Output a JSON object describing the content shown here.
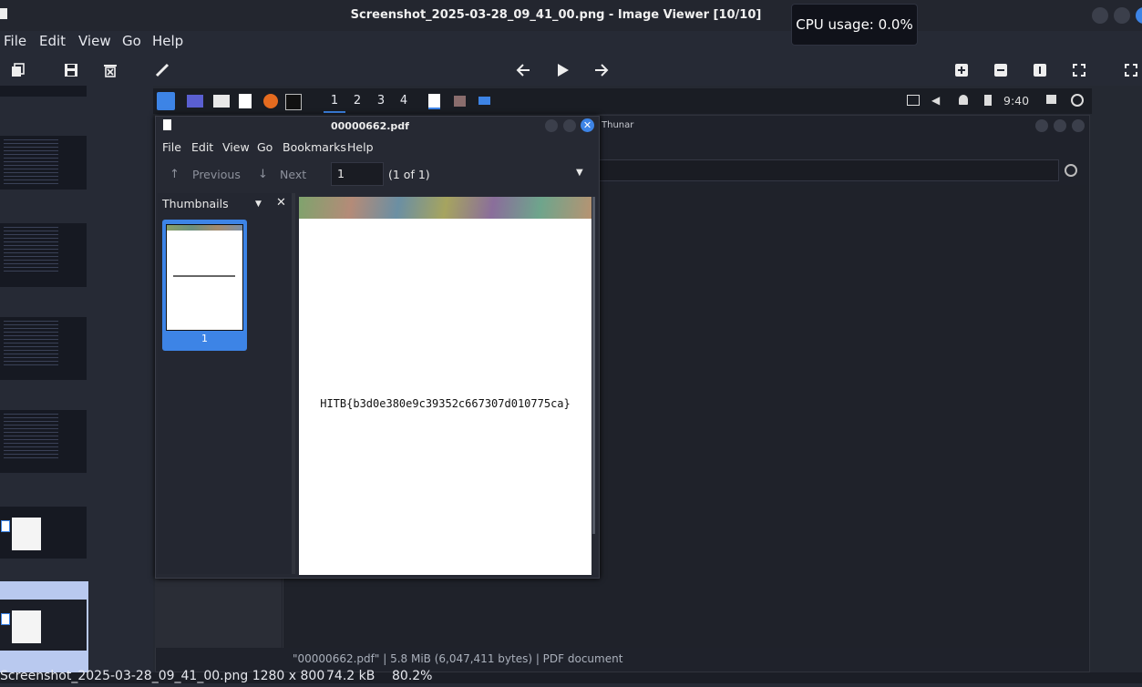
{
  "window": {
    "title": "Screenshot_2025-03-28_09_41_00.png - Image Viewer [10/10]",
    "tooltip": "CPU usage: 0.0%"
  },
  "menu": [
    "File",
    "Edit",
    "View",
    "Go",
    "Help"
  ],
  "toolbar": {
    "left_icons": [
      "copy-icon",
      "save-icon",
      "trash-icon",
      "pencil-icon"
    ],
    "nav_icons": [
      "arrow-left-icon",
      "play-icon",
      "arrow-right-icon"
    ],
    "right_icons": [
      "zoom-in-icon",
      "zoom-out-icon",
      "actual-size-icon",
      "fit-icon",
      "fullscreen-icon"
    ]
  },
  "status": {
    "filename": "Screenshot_2025-03-28_09_41_00.png 1280 x 800",
    "size": "74.2 kB",
    "zoom": "80.2%"
  },
  "screenshot": {
    "panel": {
      "workspaces": [
        "1",
        "2",
        "3",
        "4"
      ],
      "clock": "9:40"
    },
    "thunar": {
      "title": "Thunar",
      "status": "\"00000662.pdf\" | 5.8 MiB (6,047,411 bytes) | PDF document"
    },
    "pdf": {
      "title": "00000662.pdf",
      "menu": [
        "File",
        "Edit",
        "View",
        "Go",
        "Bookmarks",
        "Help"
      ],
      "previous": "Previous",
      "next": "Next",
      "page_input": "1",
      "page_count": "(1 of 1)",
      "sidebar_label": "Thumbnails",
      "thumb_page": "1",
      "content": "HITB{b3d0e380e9c39352c667307d010775ca}"
    }
  }
}
